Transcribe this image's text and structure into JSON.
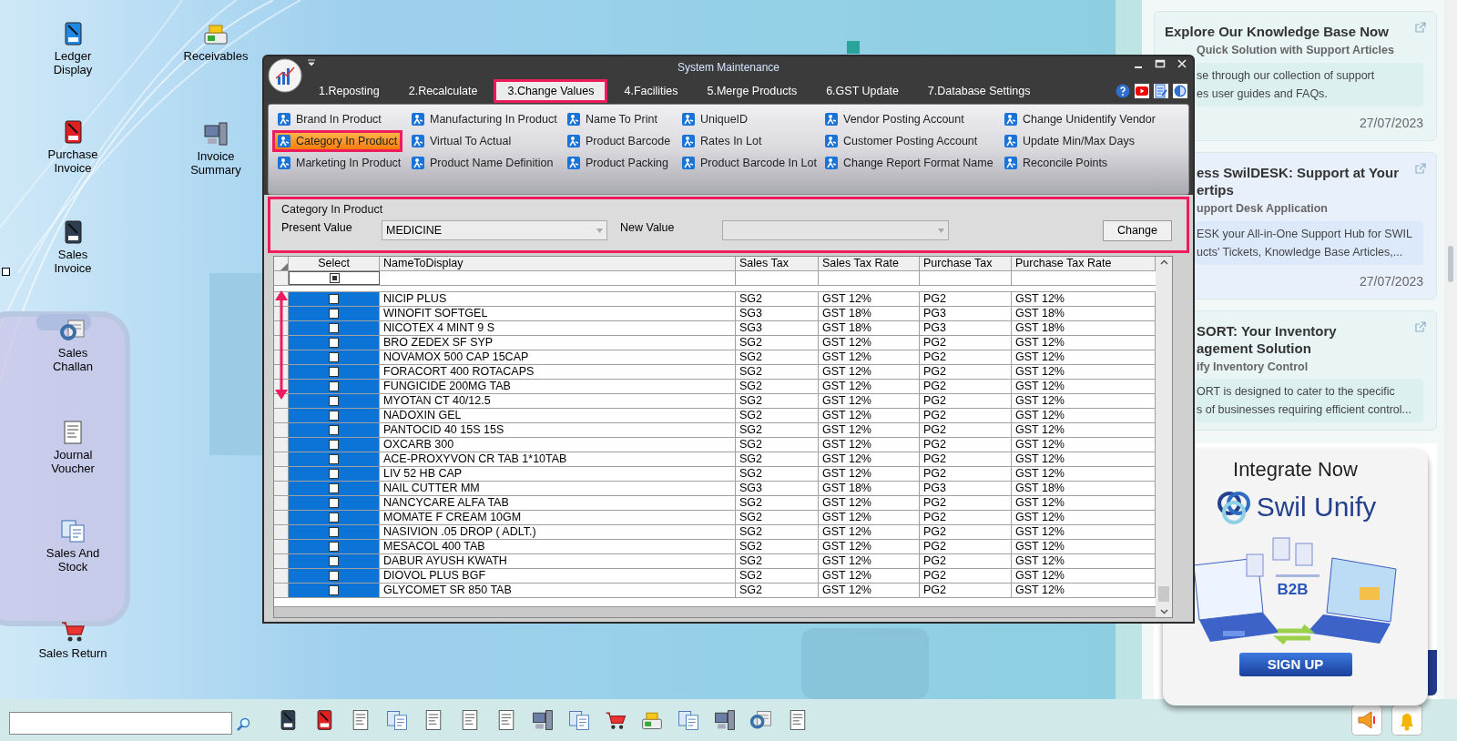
{
  "desktop_icons": [
    {
      "label": "Ledger Display"
    },
    {
      "label": "Receivables"
    },
    {
      "label": "Purchase Invoice"
    },
    {
      "label": "Invoice Summary"
    },
    {
      "label": "Sales Invoice"
    },
    {
      "label": "Sales Challan"
    },
    {
      "label": "Journal Voucher"
    },
    {
      "label": "Sales And Stock"
    },
    {
      "label": "Sales Return"
    }
  ],
  "window": {
    "title": "System Maintenance",
    "tabs": [
      {
        "label": "1.Reposting",
        "selected": false
      },
      {
        "label": "2.Recalculate",
        "selected": false
      },
      {
        "label": "3.Change Values",
        "selected": true
      },
      {
        "label": "4.Facilities",
        "selected": false
      },
      {
        "label": "5.Merge Products",
        "selected": false
      },
      {
        "label": "6.GST Update",
        "selected": false
      },
      {
        "label": "7.Database Settings",
        "selected": false
      }
    ],
    "ribbon": [
      {
        "label": "Brand In Product",
        "selected": false
      },
      {
        "label": "Category In Product",
        "selected": true
      },
      {
        "label": "Marketing In Product",
        "selected": false
      },
      {
        "label": "Manufacturing In Product",
        "selected": false
      },
      {
        "label": "Virtual To Actual",
        "selected": false
      },
      {
        "label": "Product Name Definition",
        "selected": false
      },
      {
        "label": "Name To Print",
        "selected": false
      },
      {
        "label": "Product Barcode",
        "selected": false
      },
      {
        "label": "Product Packing",
        "selected": false
      },
      {
        "label": "UniqueID",
        "selected": false
      },
      {
        "label": "Rates In Lot",
        "selected": false
      },
      {
        "label": "Product Barcode In Lot",
        "selected": false
      },
      {
        "label": "Vendor Posting Account",
        "selected": false
      },
      {
        "label": "Customer Posting Account",
        "selected": false
      },
      {
        "label": "Change Report Format Name",
        "selected": false
      },
      {
        "label": "Change Unidentify Vendor",
        "selected": false
      },
      {
        "label": "Update Min/Max Days",
        "selected": false
      },
      {
        "label": "Reconcile Points",
        "selected": false
      }
    ],
    "panel": {
      "title": "Category In Product",
      "present_label": "Present Value",
      "present_value": "MEDICINE",
      "new_label": "New Value",
      "button": "Change"
    },
    "table": {
      "select_header": "Select",
      "columns": [
        "NameToDisplay",
        "Sales Tax",
        "Sales Tax Rate",
        "Purchase Tax",
        "Purchase Tax Rate"
      ],
      "select_all_partial": true,
      "rows": [
        {
          "checked": false,
          "cells": [
            "NICIP PLUS",
            "SG2",
            "GST 12%",
            "PG2",
            "GST 12%"
          ]
        },
        {
          "checked": false,
          "cells": [
            "WINOFIT SOFTGEL",
            "SG3",
            "GST 18%",
            "PG3",
            "GST 18%"
          ]
        },
        {
          "checked": false,
          "cells": [
            "NICOTEX 4 MINT 9 S",
            "SG3",
            "GST 18%",
            "PG3",
            "GST 18%"
          ]
        },
        {
          "checked": false,
          "cells": [
            "BRO ZEDEX SF SYP",
            "SG2",
            "GST 12%",
            "PG2",
            "GST 12%"
          ]
        },
        {
          "checked": false,
          "cells": [
            "NOVAMOX 500 CAP 15CAP",
            "SG2",
            "GST 12%",
            "PG2",
            "GST 12%"
          ]
        },
        {
          "checked": false,
          "cells": [
            "FORACORT 400 ROTACAPS",
            "SG2",
            "GST 12%",
            "PG2",
            "GST 12%"
          ]
        },
        {
          "checked": false,
          "cells": [
            "FUNGICIDE 200MG TAB",
            "SG2",
            "GST 12%",
            "PG2",
            "GST 12%"
          ]
        },
        {
          "checked": false,
          "cells": [
            "MYOTAN CT 40/12.5",
            "SG2",
            "GST 12%",
            "PG2",
            "GST 12%"
          ]
        },
        {
          "checked": false,
          "cells": [
            "NADOXIN GEL",
            "SG2",
            "GST 12%",
            "PG2",
            "GST 12%"
          ]
        },
        {
          "checked": false,
          "cells": [
            "PANTOCID 40 15S 15S",
            "SG2",
            "GST 12%",
            "PG2",
            "GST 12%"
          ]
        },
        {
          "checked": false,
          "cells": [
            "OXCARB 300",
            "SG2",
            "GST 12%",
            "PG2",
            "GST 12%"
          ]
        },
        {
          "checked": false,
          "cells": [
            "ACE-PROXYVON CR TAB 1*10TAB",
            "SG2",
            "GST 12%",
            "PG2",
            "GST 12%"
          ]
        },
        {
          "checked": false,
          "cells": [
            "LIV 52 HB CAP",
            "SG2",
            "GST 12%",
            "PG2",
            "GST 12%"
          ]
        },
        {
          "checked": false,
          "cells": [
            "NAIL CUTTER MM",
            "SG3",
            "GST 18%",
            "PG3",
            "GST 18%"
          ]
        },
        {
          "checked": false,
          "cells": [
            "NANCYCARE ALFA TAB",
            "SG2",
            "GST 12%",
            "PG2",
            "GST 12%"
          ]
        },
        {
          "checked": false,
          "cells": [
            "MOMATE F CREAM 10GM",
            "SG2",
            "GST 12%",
            "PG2",
            "GST 12%"
          ]
        },
        {
          "checked": false,
          "cells": [
            "NASIVION .05 DROP ( ADLT.)",
            "SG2",
            "GST 12%",
            "PG2",
            "GST 12%"
          ]
        },
        {
          "checked": false,
          "cells": [
            "MESACOL 400 TAB",
            "SG2",
            "GST 12%",
            "PG2",
            "GST 12%"
          ]
        },
        {
          "checked": false,
          "cells": [
            "DABUR AYUSH KWATH",
            "SG2",
            "GST 12%",
            "PG2",
            "GST 12%"
          ]
        },
        {
          "checked": false,
          "cells": [
            "DIOVOL PLUS BGF",
            "SG2",
            "GST 12%",
            "PG2",
            "GST 12%"
          ]
        },
        {
          "checked": false,
          "cells": [
            "GLYCOMET SR 850 TAB",
            "SG2",
            "GST 12%",
            "PG2",
            "GST 12%"
          ]
        }
      ]
    }
  },
  "side_panel": {
    "cards": [
      {
        "title": [
          "Explore Our Knowledge Base Now"
        ],
        "subtitle": "Quick Solution with Support Articles",
        "body": [
          "se through our collection of support",
          "es user guides and FAQs."
        ],
        "date": "27/07/2023"
      },
      {
        "title": [
          "ess SwilDESK: Support at Your",
          "ertips"
        ],
        "subtitle": "upport Desk Application",
        "body": [
          "ESK your All-in-One Support Hub for SWIL",
          "ucts' Tickets, Knowledge Base Articles,..."
        ],
        "date": "27/07/2023"
      },
      {
        "title": [
          "SORT: Your Inventory",
          "agement Solution"
        ],
        "subtitle": "ify Inventory Control",
        "body": [
          "ORT is designed to cater to the specific",
          "s of businesses requiring efficient control..."
        ]
      }
    ],
    "banner": {
      "heading": "Integrate Now",
      "brand": "Swil Unify",
      "badge": "B2B",
      "button": "SIGN UP"
    }
  }
}
